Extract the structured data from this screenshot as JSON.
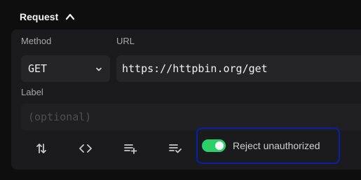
{
  "request": {
    "section_title": "Request",
    "method_label": "Method",
    "url_label": "URL",
    "method_value": "GET",
    "url_value": "https://httpbin.org/get",
    "label_label": "Label",
    "label_placeholder": "(optional)",
    "toggle_label": "Reject unauthorized",
    "toggle_on": true,
    "accent_color": "#2bd06a"
  },
  "toolbar": {
    "icons": [
      "sort-arrows-icon",
      "code-icon",
      "add-list-icon",
      "checklist-icon"
    ]
  }
}
